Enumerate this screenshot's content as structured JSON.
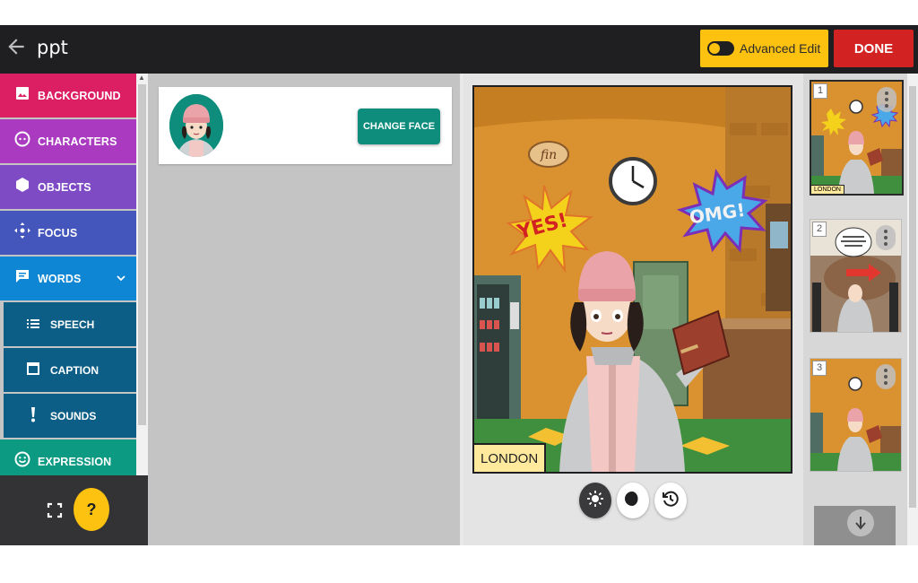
{
  "topbar": {
    "title": "ppt",
    "advanced_edit_label": "Advanced Edit",
    "done_label": "DONE"
  },
  "sidebar": {
    "items": [
      {
        "label": "BACKGROUND",
        "color": "#dc1f62",
        "icon": "image-icon"
      },
      {
        "label": "CHARACTERS",
        "color": "#aa3bc0",
        "icon": "face-icon"
      },
      {
        "label": "OBJECTS",
        "color": "#7e4bc4",
        "icon": "hexagon-icon"
      },
      {
        "label": "FOCUS",
        "color": "#4455bb",
        "icon": "move-icon"
      },
      {
        "label": "WORDS",
        "color": "#0e86d4",
        "icon": "speech-bubble-icon"
      },
      {
        "label": "SPEECH",
        "color": "#0d5e86",
        "icon": "list-icon"
      },
      {
        "label": "CAPTION",
        "color": "#0d5e86",
        "icon": "caption-box-icon"
      },
      {
        "label": "SOUNDS",
        "color": "#0d5e86",
        "icon": "exclamation-icon"
      },
      {
        "label": "EXPRESSION",
        "color": "#0c9a83",
        "icon": "smiley-icon"
      }
    ],
    "help_label": "?"
  },
  "panel": {
    "change_face_label": "CHANGE FACE"
  },
  "scene": {
    "location_caption": "LONDON",
    "sign_text": "fin",
    "yes_text": "YES!",
    "omg_text": "OMG!"
  },
  "thumbnails": [
    {
      "number": "1",
      "caption": "LONDON",
      "selected": true
    },
    {
      "number": "2",
      "caption": "",
      "selected": false
    },
    {
      "number": "3",
      "caption": "",
      "selected": false
    }
  ],
  "colors": {
    "topbar": "#1f1f22",
    "advanced_edit": "#fdc10f",
    "done": "#d32222",
    "teal": "#0e8c7c"
  }
}
